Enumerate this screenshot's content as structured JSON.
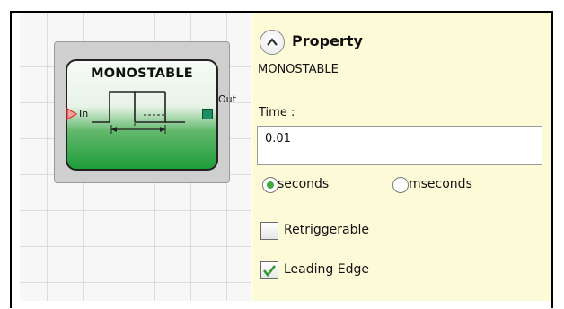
{
  "block": {
    "title": "MONOSTABLE",
    "input_label": "In",
    "output_label": "Out"
  },
  "panel": {
    "header": "Property",
    "block_name": "MONOSTABLE",
    "time_label": "Time :",
    "time_value": "0.01",
    "units": [
      {
        "label": "seconds",
        "selected": true
      },
      {
        "label": "mseconds",
        "selected": false
      }
    ],
    "options": [
      {
        "label": "Retriggerable",
        "checked": false
      },
      {
        "label": "Leading Edge",
        "checked": true
      }
    ]
  },
  "colors": {
    "panel_bg": "#fdfad8",
    "block_green": "#1f9d3a",
    "radio_selected": "#3fae3f",
    "check_green": "#2e9a2e",
    "input_arrow": "#e03030",
    "output_port": "#1b8f63"
  },
  "icons": {
    "collapse": "chevron-up-icon",
    "input_marker": "triangle-right-icon",
    "check": "checkmark-icon"
  }
}
